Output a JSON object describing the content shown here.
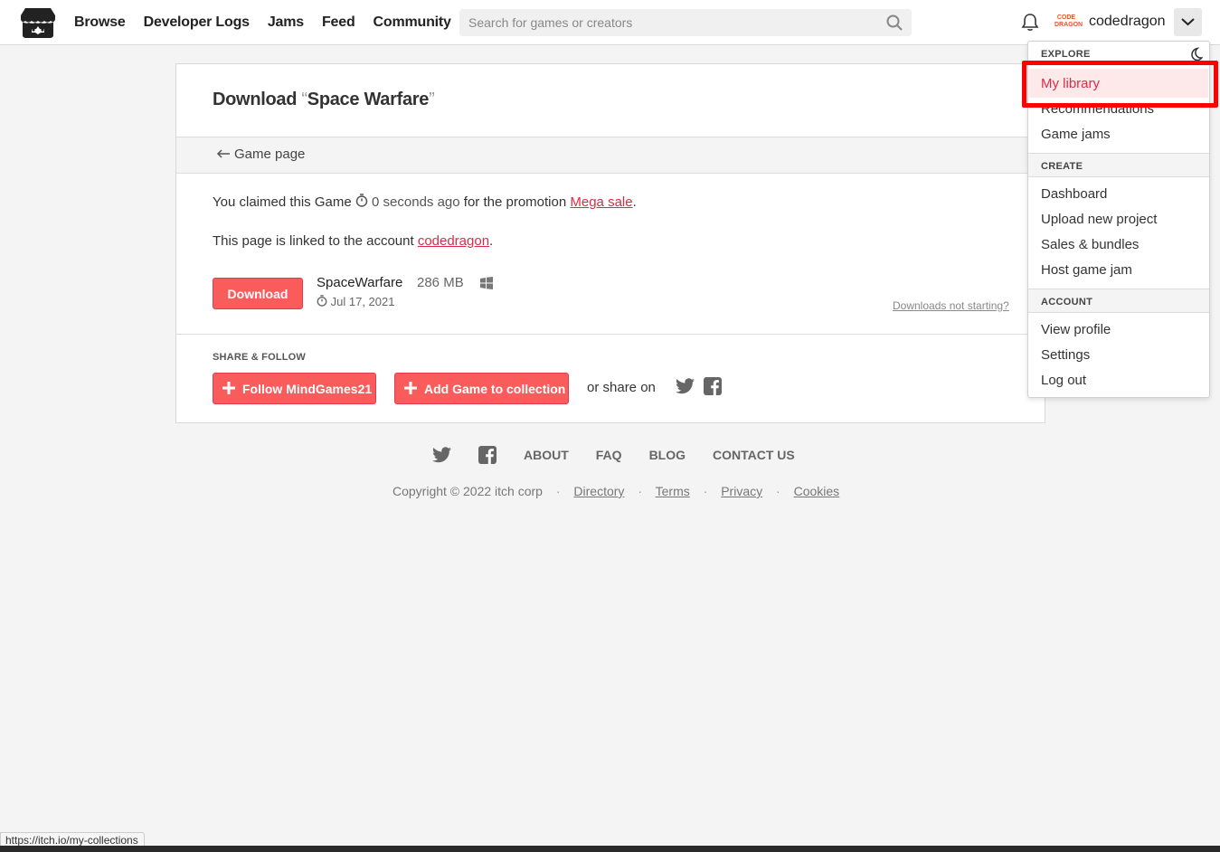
{
  "nav": {
    "browse": "Browse",
    "devlogs": "Developer Logs",
    "jams": "Jams",
    "feed": "Feed",
    "community": "Community"
  },
  "search": {
    "placeholder": "Search for games or creators"
  },
  "user": {
    "name": "codedragon",
    "avatar_text": "CODE DRAGON"
  },
  "page": {
    "title_prefix": "Download ",
    "open_quote": "“",
    "game_name": "Space Warfare",
    "close_quote": "”",
    "back_link": "Game page",
    "claim_text": "You claimed this Game",
    "claim_time": "0 seconds ago",
    "claim_middle": "for the promotion",
    "promo_link": "Mega sale",
    "period": ".",
    "linked_text": "This page is linked to the account",
    "linked_account": "codedragon",
    "download_label": "Download",
    "upload_name": "SpaceWarfare",
    "upload_size": "286 MB",
    "upload_date": "Jul 17, 2021",
    "not_starting": "Downloads not starting?"
  },
  "share": {
    "heading": "SHARE & FOLLOW",
    "follow_label": "Follow MindGames21",
    "collection_label": "Add Game to collection",
    "or_share": "or share on"
  },
  "footer": {
    "about": "ABOUT",
    "faq": "FAQ",
    "blog": "BLOG",
    "contact": "CONTACT US",
    "copyright": "Copyright © 2022 itch corp",
    "directory": "Directory",
    "terms": "Terms",
    "privacy": "Privacy",
    "cookies": "Cookies",
    "separator": "·"
  },
  "menu": {
    "explore": "EXPLORE",
    "my_library": "My library",
    "recommendations": "Recommendations",
    "game_jams": "Game jams",
    "create": "CREATE",
    "dashboard": "Dashboard",
    "upload": "Upload new project",
    "sales": "Sales & bundles",
    "host": "Host game jam",
    "account": "ACCOUNT",
    "view_profile": "View profile",
    "settings": "Settings",
    "logout": "Log out"
  },
  "status_url": "https://itch.io/my-collections",
  "colors": {
    "accent": "#fa5c5c",
    "link": "#da2c49",
    "highlight": "#ff0000"
  }
}
